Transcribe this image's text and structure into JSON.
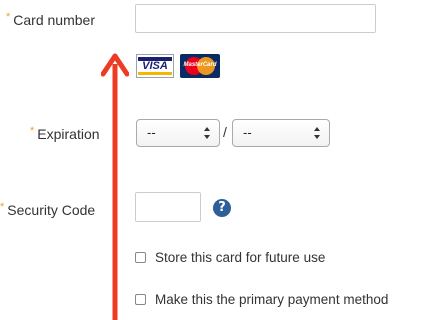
{
  "card_number": {
    "required_mark": "*",
    "label": "Card number",
    "value": "",
    "placeholder": ""
  },
  "card_logos": {
    "visa": {
      "text": "VISA",
      "color": "#1a1f71",
      "accent": "#f7b600"
    },
    "mastercard": {
      "text": "MasterCard",
      "colors": [
        "#eb001b",
        "#f79e1b"
      ]
    }
  },
  "expiration": {
    "required_mark": "*",
    "label": "Expiration",
    "month": {
      "selected": "--"
    },
    "separator": "/",
    "year": {
      "selected": "--"
    }
  },
  "security_code": {
    "required_mark": "*",
    "label": "Security Code",
    "value": "",
    "help_icon": "?"
  },
  "options": {
    "store_card": {
      "label": "Store this card for future use",
      "checked": false
    },
    "primary_method": {
      "label": "Make this the primary payment method",
      "checked": false
    }
  },
  "annotation": {
    "arrow_color": "#ee3b24",
    "direction": "up"
  },
  "colors": {
    "required": "#f0a030",
    "help_icon": "#2f5f98"
  }
}
